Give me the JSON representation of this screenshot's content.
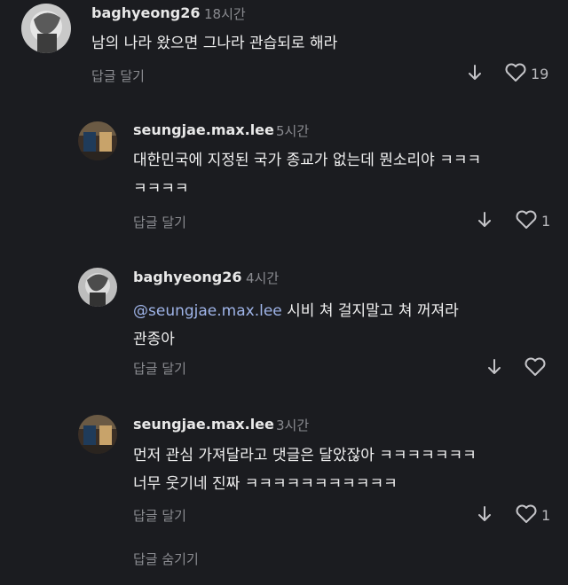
{
  "comments": [
    {
      "username": "baghyeong26",
      "time": "18시간",
      "lines": [
        "남의 나라 왔으면 그나라 관습되로 해라"
      ],
      "reply_label": "답글 달기",
      "likes": "19"
    },
    {
      "username": "seungjae.max.lee",
      "time": "5시간",
      "lines": [
        "대한민국에 지정된 국가 종교가 없는데 뭔소리야 ㅋㅋㅋ",
        "ㅋㅋㅋㅋ"
      ],
      "reply_label": "답글 달기",
      "likes": "1"
    },
    {
      "username": "baghyeong26",
      "time": "4시간",
      "mention": "@seungjae.max.lee",
      "lines": [
        " 시비 쳐 걸지말고  쳐 꺼져라",
        "관종아"
      ],
      "reply_label": "답글 달기",
      "likes": ""
    },
    {
      "username": "seungjae.max.lee",
      "time": "3시간",
      "lines": [
        "먼저 관심 가져달라고 댓글은 달았잖아 ㅋㅋㅋㅋㅋㅋㅋ",
        "너무 웃기네 진짜 ㅋㅋㅋㅋㅋㅋㅋㅋㅋㅋㅋ"
      ],
      "reply_label": "답글 달기",
      "likes": "1"
    }
  ],
  "hide_replies_label": "답글 숨기기",
  "icons": {
    "dislike": "arrow-down-icon",
    "like": "heart-icon"
  },
  "colors": {
    "background": "#1b1c20",
    "mention": "#9fb4e8",
    "muted": "#8a8b90"
  }
}
